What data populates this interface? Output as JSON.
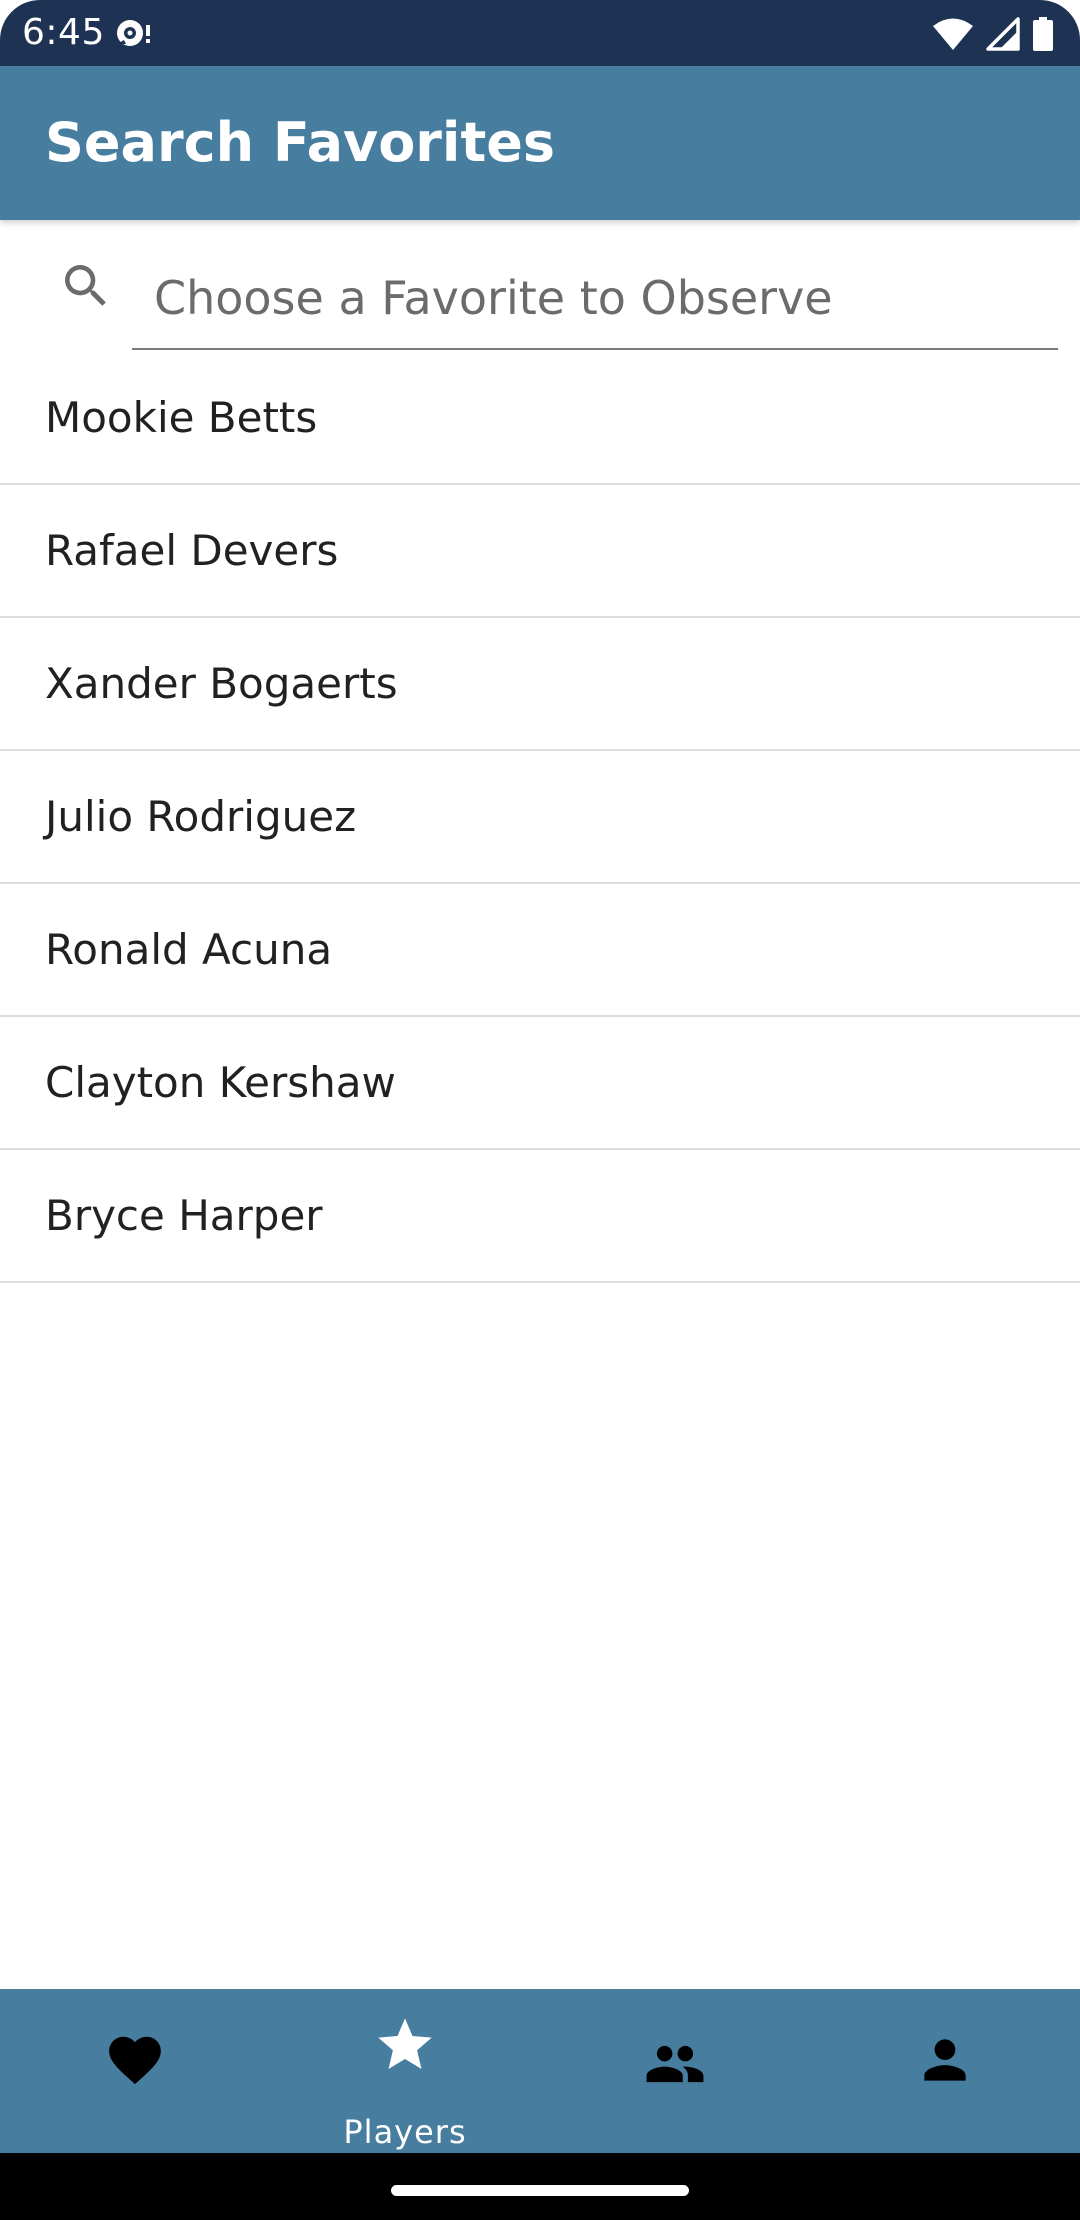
{
  "status_bar": {
    "time": "6:45",
    "icons": [
      "notification-icon",
      "wifi-icon",
      "signal-icon",
      "battery-icon"
    ]
  },
  "app_bar": {
    "title": "Search Favorites",
    "color": "#477d9f"
  },
  "search": {
    "placeholder": "Choose a Favorite to Observe",
    "value": "",
    "icon": "search-icon"
  },
  "players": [
    {
      "name": "Mookie Betts"
    },
    {
      "name": "Rafael Devers"
    },
    {
      "name": "Xander Bogaerts"
    },
    {
      "name": "Julio Rodriguez"
    },
    {
      "name": "Ronald Acuna"
    },
    {
      "name": "Clayton Kershaw"
    },
    {
      "name": "Bryce Harper"
    }
  ],
  "bottom_nav": {
    "items": [
      {
        "icon": "heart-icon",
        "label": "",
        "active": false
      },
      {
        "icon": "star-icon",
        "label": "Players",
        "active": true
      },
      {
        "icon": "people-icon",
        "label": "",
        "active": false
      },
      {
        "icon": "person-icon",
        "label": "",
        "active": false
      }
    ]
  },
  "colors": {
    "status_bar": "#1e3253",
    "primary": "#477d9f"
  }
}
